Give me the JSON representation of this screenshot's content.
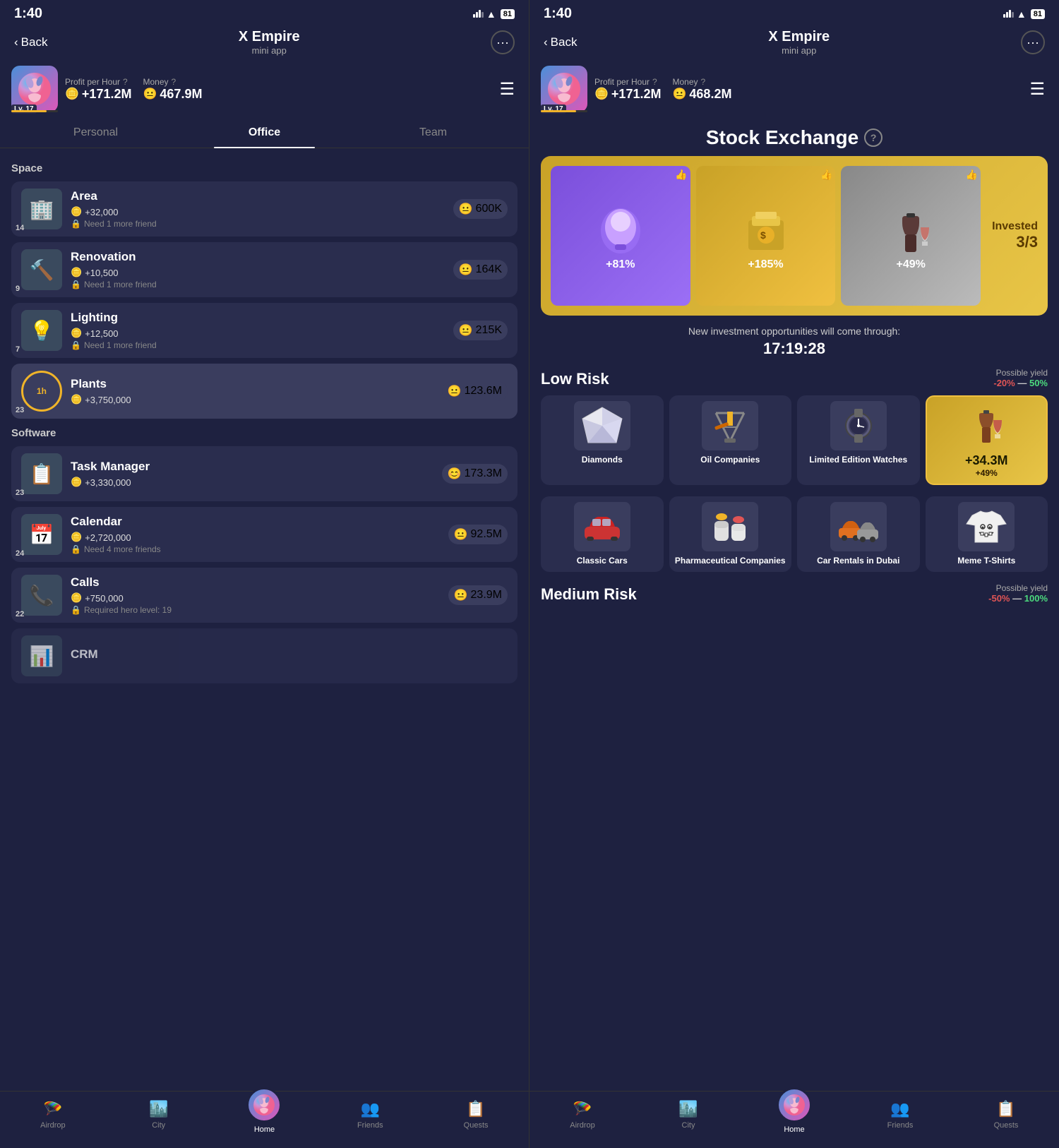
{
  "left_panel": {
    "status_bar": {
      "time": "1:40",
      "battery": "81"
    },
    "header": {
      "back_label": "Back",
      "title": "X Empire",
      "subtitle": "mini app"
    },
    "profile": {
      "level": "Lv. 17",
      "level_pct": "76%",
      "profit_label": "Profit per Hour",
      "profit_value": "+171.2M",
      "money_label": "Money",
      "money_value": "467.9M"
    },
    "tabs": [
      "Personal",
      "Office",
      "Team"
    ],
    "active_tab": 1,
    "sections": [
      {
        "title": "Space",
        "items": [
          {
            "level": "14",
            "icon": "🏢",
            "name": "Area",
            "profit": "+32,000",
            "lock": "Need 1 more friend",
            "cost": "600K"
          },
          {
            "level": "9",
            "icon": "🔨",
            "name": "Renovation",
            "profit": "+10,500",
            "lock": "Need 1 more friend",
            "cost": "164K"
          },
          {
            "level": "7",
            "icon": "💡",
            "name": "Lighting",
            "profit": "+12,500",
            "lock": "Need 1 more friend",
            "cost": "215K"
          },
          {
            "level": "23",
            "icon": "🌿",
            "name": "Plants",
            "profit": "+3,750,000",
            "lock": null,
            "cost": "123.6M",
            "timer": true
          }
        ]
      },
      {
        "title": "Software",
        "items": [
          {
            "level": "23",
            "icon": "📋",
            "name": "Task Manager",
            "profit": "+3,330,000",
            "lock": null,
            "cost": "173.3M"
          },
          {
            "level": "24",
            "icon": "📅",
            "name": "Calendar",
            "profit": "+2,720,000",
            "lock": "Need 4 more friends",
            "cost": "92.5M"
          },
          {
            "level": "22",
            "icon": "📞",
            "name": "Calls",
            "profit": "+750,000",
            "lock": "Required hero level: 19",
            "cost": "23.9M"
          },
          {
            "level": "",
            "icon": "📊",
            "name": "CRM",
            "profit": "",
            "lock": null,
            "cost": ""
          }
        ]
      }
    ],
    "bottom_nav": {
      "items": [
        "Airdrop",
        "City",
        "Home",
        "Friends",
        "Quests"
      ],
      "active": 2,
      "icons": [
        "🪂",
        "🏙️",
        "👤",
        "👥",
        "📋"
      ]
    }
  },
  "right_panel": {
    "status_bar": {
      "time": "1:40",
      "battery": "81"
    },
    "header": {
      "back_label": "Back",
      "title": "X Empire",
      "subtitle": "mini app"
    },
    "profile": {
      "level": "Lv. 17",
      "level_pct": "76%",
      "profit_label": "Profit per Hour",
      "profit_value": "+171.2M",
      "money_label": "Money",
      "money_value": "468.2M"
    },
    "stock_exchange": {
      "title": "Stock Exchange",
      "investments": [
        {
          "pct": "+81%",
          "color": "purple"
        },
        {
          "pct": "+185%",
          "color": "gold"
        },
        {
          "pct": "+49%",
          "color": "grey"
        }
      ],
      "invested_label": "Invested",
      "invested_count": "3/3",
      "countdown_label": "New investment opportunities will come through:",
      "countdown_time": "17:19:28"
    },
    "low_risk": {
      "title": "Low Risk",
      "yield_label": "Possible yield",
      "yield_range": "-20% — 50%",
      "items": [
        {
          "name": "Diamonds",
          "icon": "💎",
          "selected": false
        },
        {
          "name": "Oil Companies",
          "icon": "🛢️",
          "selected": false
        },
        {
          "name": "Limited Edition Watches",
          "icon": "⌚",
          "selected": false
        },
        {
          "name": "Expensive Wine",
          "icon": "🍷",
          "selected": true,
          "value": "+34.3M",
          "yield": "+49%"
        }
      ]
    },
    "low_risk_row2": {
      "items": [
        {
          "name": "Classic Cars",
          "icon": "🚗",
          "selected": false
        },
        {
          "name": "Pharmaceutical Companies",
          "icon": "💊",
          "selected": false
        },
        {
          "name": "Car Rentals in Dubai",
          "icon": "🚙",
          "selected": false
        },
        {
          "name": "Meme T-Shirts",
          "icon": "👕",
          "selected": false
        }
      ]
    },
    "medium_risk": {
      "title": "Medium Risk",
      "yield_label": "Possible yield",
      "yield_range": "-50% — 100%"
    },
    "bottom_nav": {
      "items": [
        "Airdrop",
        "City",
        "Home",
        "Friends",
        "Quests"
      ],
      "active": 2,
      "icons": [
        "🪂",
        "🏙️",
        "👤",
        "👥",
        "📋"
      ]
    }
  }
}
